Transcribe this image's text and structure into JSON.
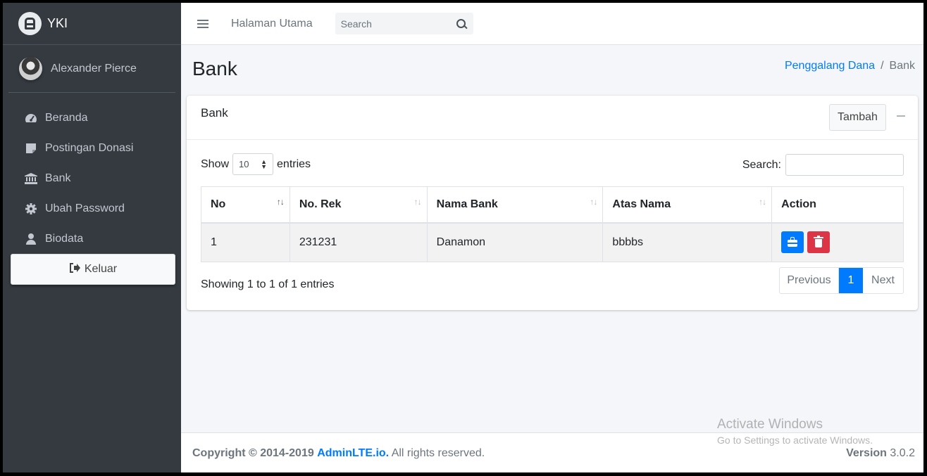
{
  "brand": {
    "name": "YKI"
  },
  "user": {
    "name": "Alexander Pierce"
  },
  "sidebar": {
    "items": [
      {
        "label": "Beranda",
        "icon": "tachometer-icon"
      },
      {
        "label": "Postingan Donasi",
        "icon": "sticky-note-icon"
      },
      {
        "label": "Bank",
        "icon": "university-icon"
      },
      {
        "label": "Ubah Password",
        "icon": "cog-icon"
      },
      {
        "label": "Biodata",
        "icon": "user-icon"
      }
    ],
    "logout_label": "Keluar"
  },
  "topbar": {
    "home_label": "Halaman Utama",
    "search_placeholder": "Search"
  },
  "page": {
    "title": "Bank",
    "breadcrumb": {
      "parent": "Penggalang Dana",
      "separator": "/",
      "current": "Bank"
    }
  },
  "card": {
    "title": "Bank",
    "add_label": "Tambah",
    "show_label": "Show",
    "entries_label": "entries",
    "page_length": "10",
    "search_label": "Search:",
    "columns": [
      "No",
      "No. Rek",
      "Nama Bank",
      "Atas Nama",
      "Action"
    ],
    "rows": [
      {
        "no": "1",
        "rek": "231231",
        "bank": "Danamon",
        "nama": "bbbbs"
      }
    ],
    "info": "Showing 1 to 1 of 1 entries",
    "pagination": {
      "previous": "Previous",
      "current": "1",
      "next": "Next"
    }
  },
  "footer": {
    "copyright_prefix": "Copyright © 2014-2019",
    "brand_link": "AdminLTE.io.",
    "rights": "All rights reserved.",
    "version_label": "Version",
    "version": "3.0.2"
  },
  "watermark": {
    "line1": "Activate Windows",
    "line2": "Go to Settings to activate Windows."
  },
  "colors": {
    "sidebar_bg": "#343a40",
    "primary": "#007bff",
    "danger": "#dc3545",
    "content_bg": "#f4f6f9"
  }
}
